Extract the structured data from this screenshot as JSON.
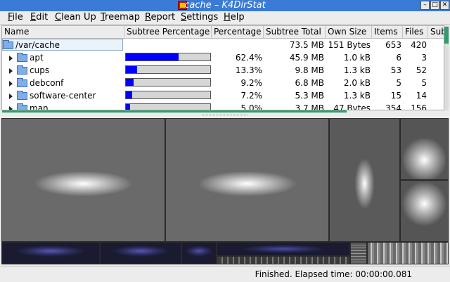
{
  "window": {
    "title": "cache – K4DirStat",
    "app_icon": "k4dirstat-app-icon",
    "buttons": [
      "minimize-icon",
      "maximize-icon",
      "close-icon"
    ]
  },
  "menubar": {
    "items": [
      {
        "label": "File",
        "mnemonic": "F",
        "rest": "ile"
      },
      {
        "label": "Edit",
        "mnemonic": "E",
        "rest": "dit"
      },
      {
        "label": "Clean Up",
        "mnemonic": "C",
        "rest": "lean Up"
      },
      {
        "label": "Treemap",
        "mnemonic": "T",
        "rest": "reemap"
      },
      {
        "label": "Report",
        "mnemonic": "R",
        "rest": "eport"
      },
      {
        "label": "Settings",
        "mnemonic": "S",
        "rest": "ettings"
      },
      {
        "label": "Help",
        "mnemonic": "H",
        "rest": "elp"
      }
    ]
  },
  "tree": {
    "columns": [
      "Name",
      "Subtree Percentage",
      "Percentage",
      "Subtree Total",
      "Own Size",
      "Items",
      "Files",
      "Sub"
    ],
    "root": {
      "name": "/var/cache",
      "subtree_total": "73.5 MB",
      "own_size": "151 Bytes",
      "items": "653",
      "files": "420"
    },
    "rows": [
      {
        "name": "apt",
        "percentage": "62.4%",
        "fraction": 0.624,
        "subtree_total": "45.9 MB",
        "own_size": "1.0 kB",
        "items": "6",
        "files": "3"
      },
      {
        "name": "cups",
        "percentage": "13.3%",
        "fraction": 0.133,
        "subtree_total": "9.8 MB",
        "own_size": "1.3 kB",
        "items": "53",
        "files": "52"
      },
      {
        "name": "debconf",
        "percentage": "9.2%",
        "fraction": 0.092,
        "subtree_total": "6.8 MB",
        "own_size": "2.0 kB",
        "items": "5",
        "files": "5"
      },
      {
        "name": "software-center",
        "percentage": "7.2%",
        "fraction": 0.072,
        "subtree_total": "5.3 MB",
        "own_size": "1.3 kB",
        "items": "15",
        "files": "14"
      },
      {
        "name": "man",
        "percentage": "5.0%",
        "fraction": 0.05,
        "subtree_total": "3.7 MB",
        "own_size": "47 Bytes",
        "items": "354",
        "files": "156"
      }
    ]
  },
  "colors": {
    "title_bar": "#3a7bd5",
    "percentage_bar": "#0000ff",
    "scrollbar": "#2e9e6a"
  },
  "status": {
    "text": "Finished. Elapsed time: 00:00:00.081"
  }
}
